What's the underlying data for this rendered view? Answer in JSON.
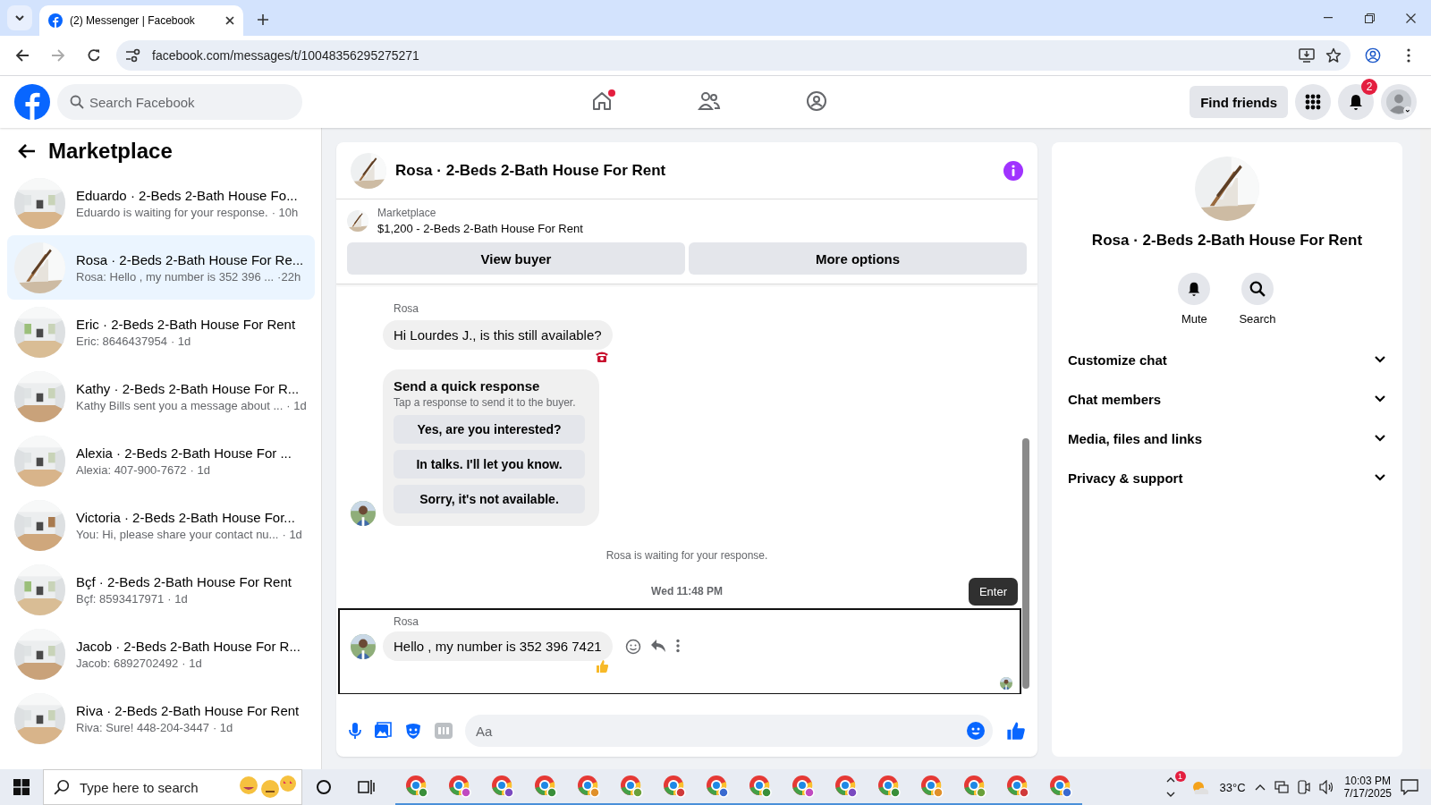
{
  "browser": {
    "tab_title": "(2) Messenger | Facebook",
    "url": "facebook.com/messages/t/10048356295275271"
  },
  "header": {
    "search_placeholder": "Search Facebook",
    "nav": [
      {
        "kind": "home",
        "selected": false,
        "dot": true
      },
      {
        "kind": "friends",
        "selected": false,
        "dot": false
      },
      {
        "kind": "groups",
        "selected": false,
        "dot": false
      }
    ],
    "find_friends": "Find friends",
    "notification_count": "2"
  },
  "sidebar": {
    "title": "Marketplace",
    "conversations": [
      {
        "name": "Eduardo · 2-Beds 2-Bath House Fo...",
        "preview": "Eduardo is waiting for your response.",
        "time": "· 10h",
        "selected": false
      },
      {
        "name": "Rosa · 2-Beds 2-Bath House For Re...",
        "preview": "Rosa: Hello , my number is 352 396 ...",
        "time": "·22h",
        "selected": true
      },
      {
        "name": "Eric · 2-Beds 2-Bath House For Rent",
        "preview": "Eric: 8646437954",
        "time": "· 1d",
        "selected": false
      },
      {
        "name": "Kathy · 2-Beds 2-Bath House For R...",
        "preview": "Kathy Bills sent you a message about ...",
        "time": "· 1d",
        "selected": false
      },
      {
        "name": "Alexia · 2-Beds 2-Bath House For ...",
        "preview": "Alexia: 407-900-7672",
        "time": "· 1d",
        "selected": false
      },
      {
        "name": "Victoria · 2-Beds 2-Bath House For...",
        "preview": "You: Hi, please share your contact nu...",
        "time": "· 1d",
        "selected": false
      },
      {
        "name": "Bçf · 2-Beds 2-Bath House For Rent",
        "preview": "Bçf: 8593417971",
        "time": "· 1d",
        "selected": false
      },
      {
        "name": "Jacob · 2-Beds 2-Bath House For R...",
        "preview": "Jacob: 6892702492",
        "time": "· 1d",
        "selected": false
      },
      {
        "name": "Riva · 2-Beds 2-Bath House For Rent",
        "preview": "Riva: Sure! 448-204-3447",
        "time": "· 1d",
        "selected": false
      }
    ]
  },
  "chat": {
    "title": "Rosa · 2-Beds 2-Bath House For Rent",
    "listing": {
      "label": "Marketplace",
      "title": "$1,200 - 2-Beds 2-Bath House For Rent"
    },
    "actions": [
      "View buyer",
      "More options"
    ],
    "first_message": {
      "sender": "Rosa",
      "text": "Hi Lourdes J., is this still available?"
    },
    "quick_response": {
      "title": "Send a quick response",
      "subtitle": "Tap a response to send it to the buyer.",
      "options": [
        "Yes, are you interested?",
        "In talks. I'll let you know.",
        "Sorry, it's not available."
      ]
    },
    "status": "Rosa is waiting for your response.",
    "timestamp": "Wed 11:48 PM",
    "tooltip": "Enter",
    "last_message": {
      "sender": "Rosa",
      "text": "Hello , my number is 352 396 7421"
    },
    "composer_placeholder": "Aa"
  },
  "details": {
    "title": "Rosa · 2-Beds 2-Bath House For Rent",
    "actions": [
      {
        "kind": "mute",
        "label": "Mute"
      },
      {
        "kind": "search",
        "label": "Search"
      }
    ],
    "sections": [
      {
        "label": "Customize chat",
        "expanded": false
      },
      {
        "label": "Chat members",
        "expanded": false
      },
      {
        "label": "Media, files and links",
        "expanded": false
      },
      {
        "label": "Privacy & support",
        "expanded": false
      }
    ]
  },
  "taskbar": {
    "search_placeholder": "Type here to search",
    "weather_alert": "1",
    "temperature": "33°C",
    "time": "10:03 PM",
    "date": "7/17/2025"
  }
}
